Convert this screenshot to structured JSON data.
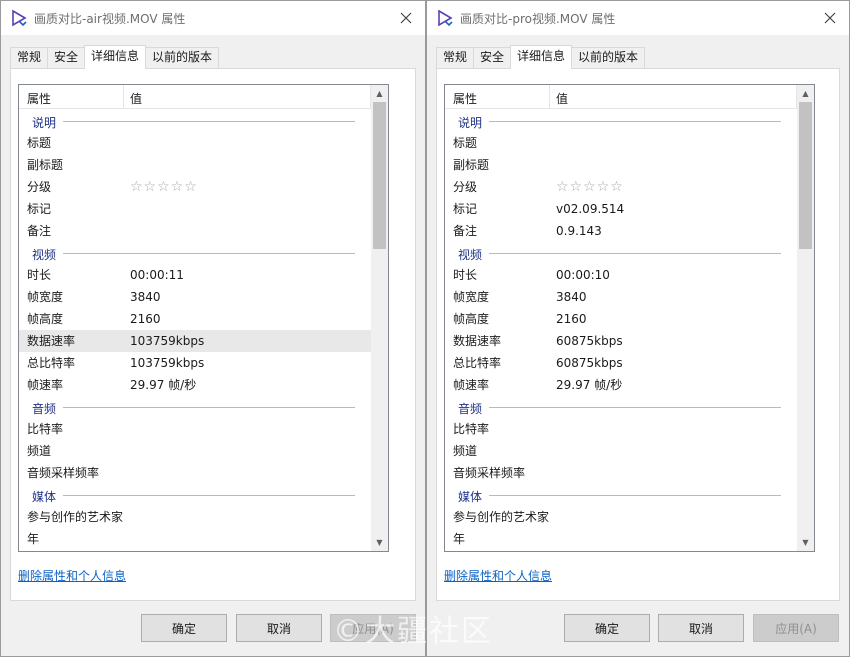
{
  "left": {
    "title": "画质对比-air视频.MOV 属性",
    "tabs": [
      "常规",
      "安全",
      "详细信息",
      "以前的版本"
    ],
    "header": {
      "col1": "属性",
      "col2": "值"
    },
    "groups": {
      "desc": "说明",
      "video": "视频",
      "audio": "音频",
      "media": "媒体"
    },
    "fields": {
      "title": {
        "k": "标题",
        "v": ""
      },
      "subtitle": {
        "k": "副标题",
        "v": ""
      },
      "rating": {
        "k": "分级",
        "v": "☆☆☆☆☆"
      },
      "tags": {
        "k": "标记",
        "v": ""
      },
      "comments": {
        "k": "备注",
        "v": ""
      },
      "duration": {
        "k": "时长",
        "v": "00:00:11"
      },
      "width": {
        "k": "帧宽度",
        "v": "3840"
      },
      "height": {
        "k": "帧高度",
        "v": "2160"
      },
      "datarate": {
        "k": "数据速率",
        "v": "103759kbps"
      },
      "bitrate": {
        "k": "总比特率",
        "v": "103759kbps"
      },
      "framerate": {
        "k": "帧速率",
        "v": "29.97 帧/秒"
      },
      "abitrate": {
        "k": "比特率",
        "v": ""
      },
      "channels": {
        "k": "频道",
        "v": ""
      },
      "samplerate": {
        "k": "音频采样频率",
        "v": ""
      },
      "artists": {
        "k": "参与创作的艺术家",
        "v": ""
      },
      "year": {
        "k": "年",
        "v": ""
      }
    },
    "link": "删除属性和个人信息",
    "buttons": {
      "ok": "确定",
      "cancel": "取消",
      "apply": "应用(A)"
    }
  },
  "right": {
    "title": "画质对比-pro视频.MOV 属性",
    "tabs": [
      "常规",
      "安全",
      "详细信息",
      "以前的版本"
    ],
    "header": {
      "col1": "属性",
      "col2": "值"
    },
    "groups": {
      "desc": "说明",
      "video": "视频",
      "audio": "音频",
      "media": "媒体"
    },
    "fields": {
      "title": {
        "k": "标题",
        "v": ""
      },
      "subtitle": {
        "k": "副标题",
        "v": ""
      },
      "rating": {
        "k": "分级",
        "v": "☆☆☆☆☆"
      },
      "tags": {
        "k": "标记",
        "v": "v02.09.514"
      },
      "comments": {
        "k": "备注",
        "v": "0.9.143"
      },
      "duration": {
        "k": "时长",
        "v": "00:00:10"
      },
      "width": {
        "k": "帧宽度",
        "v": "3840"
      },
      "height": {
        "k": "帧高度",
        "v": "2160"
      },
      "datarate": {
        "k": "数据速率",
        "v": "60875kbps"
      },
      "bitrate": {
        "k": "总比特率",
        "v": "60875kbps"
      },
      "framerate": {
        "k": "帧速率",
        "v": "29.97 帧/秒"
      },
      "abitrate": {
        "k": "比特率",
        "v": ""
      },
      "channels": {
        "k": "频道",
        "v": ""
      },
      "samplerate": {
        "k": "音频采样频率",
        "v": ""
      },
      "artists": {
        "k": "参与创作的艺术家",
        "v": ""
      },
      "year": {
        "k": "年",
        "v": ""
      }
    },
    "link": "删除属性和个人信息",
    "buttons": {
      "ok": "确定",
      "cancel": "取消",
      "apply": "应用(A)"
    }
  },
  "watermark": "©大疆社区",
  "colors": {
    "accent_link": "#0b63c4",
    "group_heading": "#1e3287",
    "group_line": "#a9bdd8"
  }
}
